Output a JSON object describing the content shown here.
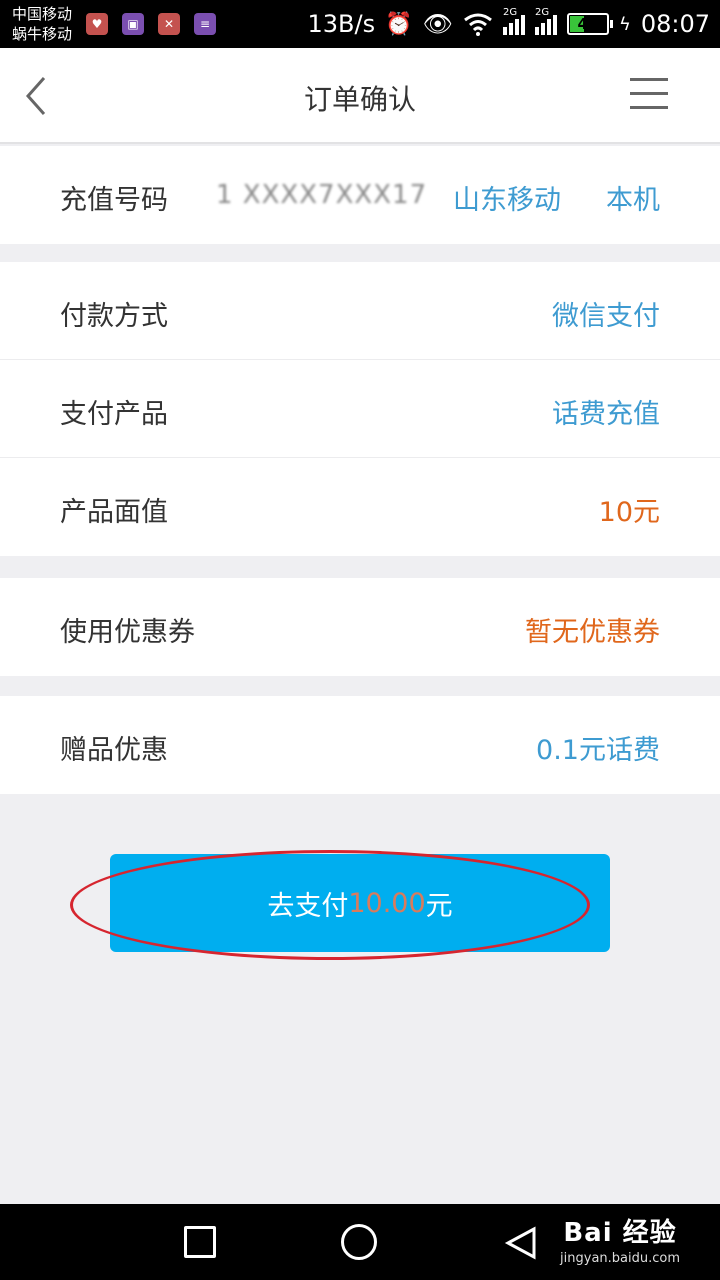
{
  "status_bar": {
    "carrier_1": "中国移动",
    "carrier_2": "蜗牛移动",
    "speed": "13B/s",
    "network_1": "2G",
    "network_2": "2G",
    "battery": "42",
    "time": "08:07"
  },
  "header": {
    "title": "订单确认"
  },
  "recharge": {
    "label": "充值号码",
    "number": "1 XXXX7XXX17",
    "carrier": "山东移动",
    "self": "本机"
  },
  "payment": {
    "rows": [
      {
        "label": "付款方式",
        "value": "微信支付"
      },
      {
        "label": "支付产品",
        "value": "话费充值"
      },
      {
        "label": "产品面值",
        "value": "10元"
      }
    ]
  },
  "coupon": {
    "label": "使用优惠券",
    "value": "暂无优惠券"
  },
  "gift": {
    "label": "赠品优惠",
    "value": "0.1元话费"
  },
  "pay_button": {
    "prefix": "去支付",
    "amount": "10.00",
    "suffix": "元"
  },
  "watermark": {
    "main": "Bai 经验",
    "sub": "jingyan.baidu.com"
  },
  "colors": {
    "accent_blue": "#3e9bd1",
    "accent_orange": "#e0671c",
    "button": "#00aeef",
    "annotation": "#d6252f"
  }
}
